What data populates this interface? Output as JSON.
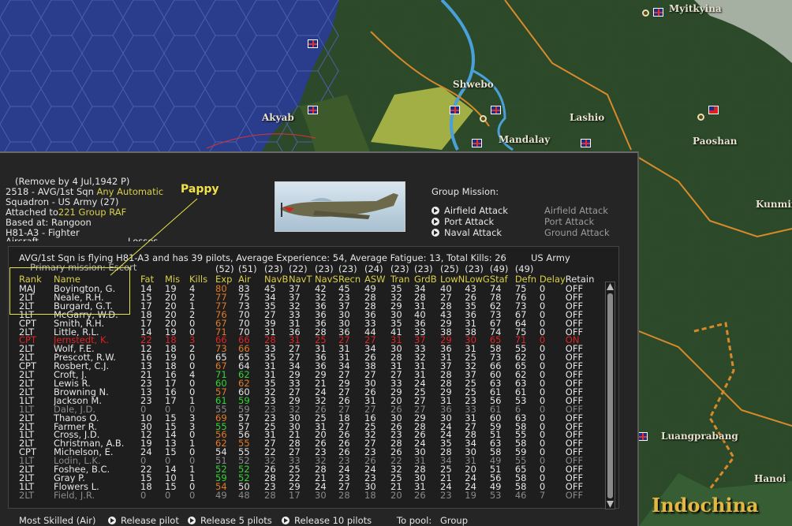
{
  "map": {
    "places": [
      "Myitkyina",
      "Akyab",
      "Shwebo",
      "Lashio",
      "Mandalay",
      "Paoshan",
      "Kunming",
      "Luangprabang",
      "Hanoi"
    ],
    "region": "Indochina",
    "flag_icon": "union-jack-flag-icon",
    "roc_flag_icon": "roc-flag-icon"
  },
  "unit": {
    "remove_line": "(Remove by  4 Jul,1942  P)",
    "id_line": "2518 - AVG/1st Sqn",
    "any": "Any",
    "automatic": "Automatic",
    "leader": "Pappy",
    "squadron_line": "Squadron - US Army (27)",
    "attached_label": "Attached to",
    "attached_value": "221 Group RAF",
    "based_line": "Based at:  Rangoon",
    "aircraft_line": "H81-A3 - Fighter",
    "aircraft_cut": "Aircraft",
    "losses_cut": "Losses"
  },
  "mission": {
    "title": "Group Mission:",
    "options": [
      "Airfield Attack",
      "Port Attack",
      "Naval Attack"
    ],
    "secondary": [
      "Airfield Attack",
      "Port Attack",
      "Ground Attack"
    ]
  },
  "summary": {
    "line": "AVG/1st Sqn is flying H81-A3 and has 39 pilots,  Average Experience: 54,  Average Fatigue: 13,  Total Kills: 26",
    "service": "US Army",
    "primary": "Primary mission: Escort"
  },
  "max_row": [
    "(52)",
    "(51)",
    "(23)",
    "(22)",
    "(23)",
    "(23)",
    "(24)",
    "(23)",
    "(23)",
    "(25)",
    "(23)",
    "(49)",
    "(49)"
  ],
  "columns": [
    "Rank",
    "Name",
    "Fat",
    "Mis",
    "Kills",
    "Exp",
    "Air",
    "NavB",
    "NavT",
    "NavS",
    "Recn",
    "ASW",
    "Tran",
    "GrdB",
    "LowN",
    "LowG",
    "Staf",
    "Defn",
    "Delay",
    "Retain"
  ],
  "pilots": [
    {
      "rank": "MAJ",
      "name": "Boyington, G.",
      "vals": [
        "14",
        "19",
        "4",
        "80",
        "83",
        "45",
        "37",
        "42",
        "45",
        "49",
        "35",
        "34",
        "40",
        "43",
        "74",
        "75",
        "0",
        "OFF"
      ],
      "s": "n",
      "c": {
        "exp": "o"
      }
    },
    {
      "rank": "2LT",
      "name": "Neale, R.H.",
      "vals": [
        "15",
        "20",
        "2",
        "77",
        "75",
        "34",
        "37",
        "32",
        "23",
        "28",
        "32",
        "28",
        "27",
        "26",
        "78",
        "76",
        "0",
        "OFF"
      ],
      "s": "n",
      "c": {
        "exp": "o"
      }
    },
    {
      "rank": "2LT",
      "name": "Burgard, G.T.",
      "vals": [
        "17",
        "20",
        "1",
        "77",
        "73",
        "35",
        "32",
        "36",
        "37",
        "28",
        "29",
        "31",
        "28",
        "35",
        "62",
        "73",
        "0",
        "OFF"
      ],
      "s": "n",
      "c": {
        "exp": "o"
      }
    },
    {
      "rank": "1LT",
      "name": "McGarry, W.D.",
      "vals": [
        "18",
        "20",
        "2",
        "76",
        "70",
        "27",
        "33",
        "36",
        "30",
        "36",
        "30",
        "40",
        "43",
        "36",
        "73",
        "67",
        "0",
        "OFF"
      ],
      "s": "n",
      "c": {
        "exp": "o"
      }
    },
    {
      "rank": "CPT",
      "name": "Smith, R.H.",
      "vals": [
        "17",
        "20",
        "0",
        "67",
        "70",
        "39",
        "31",
        "36",
        "30",
        "33",
        "35",
        "36",
        "29",
        "31",
        "67",
        "64",
        "0",
        "OFF"
      ],
      "s": "n",
      "c": {
        "exp": "o"
      }
    },
    {
      "rank": "2LT",
      "name": "Little, R.L.",
      "vals": [
        "14",
        "19",
        "0",
        "71",
        "70",
        "31",
        "36",
        "28",
        "36",
        "44",
        "41",
        "33",
        "38",
        "38",
        "74",
        "75",
        "0",
        "OFF"
      ],
      "s": "n",
      "c": {
        "exp": "o"
      }
    },
    {
      "rank": "CPT",
      "name": "Jernstedt, K.",
      "vals": [
        "22",
        "18",
        "3",
        "66",
        "66",
        "28",
        "31",
        "25",
        "27",
        "27",
        "31",
        "37",
        "29",
        "30",
        "65",
        "71",
        "0",
        "ON"
      ],
      "s": "a",
      "c": {}
    },
    {
      "rank": "2LT",
      "name": "Wolf, F.E.",
      "vals": [
        "12",
        "18",
        "2",
        "73",
        "66",
        "33",
        "27",
        "31",
        "31",
        "34",
        "30",
        "33",
        "36",
        "31",
        "58",
        "55",
        "0",
        "OFF"
      ],
      "s": "n",
      "c": {
        "exp": "o",
        "air": "o"
      }
    },
    {
      "rank": "2LT",
      "name": "Prescott, R.W.",
      "vals": [
        "16",
        "19",
        "0",
        "65",
        "65",
        "35",
        "27",
        "36",
        "31",
        "26",
        "28",
        "32",
        "31",
        "25",
        "73",
        "62",
        "0",
        "OFF"
      ],
      "s": "n",
      "c": {}
    },
    {
      "rank": "CPT",
      "name": "Rosbert, C.J.",
      "vals": [
        "13",
        "18",
        "0",
        "67",
        "64",
        "31",
        "34",
        "36",
        "34",
        "38",
        "31",
        "31",
        "37",
        "32",
        "66",
        "65",
        "0",
        "OFF"
      ],
      "s": "n",
      "c": {
        "exp": "o"
      }
    },
    {
      "rank": "2LT",
      "name": "Croft, J.",
      "vals": [
        "21",
        "16",
        "4",
        "71",
        "62",
        "31",
        "29",
        "29",
        "27",
        "27",
        "27",
        "31",
        "28",
        "37",
        "60",
        "62",
        "0",
        "OFF"
      ],
      "s": "n",
      "c": {
        "exp": "g",
        "air": "g"
      }
    },
    {
      "rank": "2LT",
      "name": "Lewis R.",
      "vals": [
        "23",
        "17",
        "0",
        "60",
        "62",
        "35",
        "33",
        "21",
        "29",
        "30",
        "33",
        "24",
        "28",
        "25",
        "63",
        "63",
        "0",
        "OFF"
      ],
      "s": "n",
      "c": {
        "exp": "g",
        "air": "o"
      }
    },
    {
      "rank": "2LT",
      "name": "Browning N.",
      "vals": [
        "13",
        "16",
        "0",
        "57",
        "60",
        "32",
        "27",
        "24",
        "27",
        "26",
        "29",
        "25",
        "29",
        "25",
        "61",
        "61",
        "0",
        "OFF"
      ],
      "s": "n",
      "c": {
        "exp": "o"
      }
    },
    {
      "rank": "1LT",
      "name": "Jackson M.",
      "vals": [
        "23",
        "17",
        "1",
        "61",
        "59",
        "23",
        "29",
        "32",
        "26",
        "31",
        "20",
        "27",
        "31",
        "23",
        "56",
        "53",
        "0",
        "OFF"
      ],
      "s": "n",
      "c": {
        "exp": "g",
        "air": "g"
      }
    },
    {
      "rank": "1LT",
      "name": "Dale, J.D.",
      "vals": [
        "0",
        "0",
        "0",
        "55",
        "59",
        "23",
        "32",
        "26",
        "27",
        "27",
        "26",
        "27",
        "36",
        "33",
        "61",
        "6",
        "0",
        "OFF"
      ],
      "s": "d",
      "c": {}
    },
    {
      "rank": "2LT",
      "name": "Thanos O.",
      "vals": [
        "10",
        "15",
        "3",
        "69",
        "57",
        "23",
        "30",
        "25",
        "18",
        "16",
        "30",
        "29",
        "30",
        "31",
        "60",
        "63",
        "0",
        "OFF"
      ],
      "s": "n",
      "c": {
        "exp": "o"
      }
    },
    {
      "rank": "2LT",
      "name": "Farmer R.",
      "vals": [
        "30",
        "15",
        "3",
        "55",
        "57",
        "25",
        "30",
        "31",
        "27",
        "25",
        "26",
        "28",
        "24",
        "27",
        "59",
        "58",
        "0",
        "OFF"
      ],
      "s": "n",
      "c": {
        "exp": "g"
      }
    },
    {
      "rank": "1LT",
      "name": "Cross, J.D.",
      "vals": [
        "12",
        "14",
        "0",
        "56",
        "56",
        "31",
        "21",
        "20",
        "26",
        "32",
        "23",
        "26",
        "24",
        "28",
        "51",
        "55",
        "0",
        "OFF"
      ],
      "s": "n",
      "c": {
        "exp": "o"
      }
    },
    {
      "rank": "2LT",
      "name": "Christman, A.B.",
      "vals": [
        "19",
        "13",
        "1",
        "62",
        "55",
        "27",
        "28",
        "26",
        "26",
        "27",
        "28",
        "24",
        "35",
        "34",
        "63",
        "58",
        "0",
        "OFF"
      ],
      "s": "n",
      "c": {
        "exp": "o",
        "air": "o"
      }
    },
    {
      "rank": "CPT",
      "name": "Michelson, E.",
      "vals": [
        "24",
        "15",
        "0",
        "54",
        "55",
        "22",
        "27",
        "23",
        "26",
        "23",
        "26",
        "30",
        "28",
        "30",
        "58",
        "59",
        "0",
        "OFF"
      ],
      "s": "n",
      "c": {}
    },
    {
      "rank": "1LT",
      "name": "Lodin, L.K.",
      "vals": [
        "0",
        "0",
        "0",
        "51",
        "52",
        "32",
        "33",
        "32",
        "23",
        "26",
        "22",
        "31",
        "34",
        "31",
        "49",
        "55",
        "0",
        "OFF"
      ],
      "s": "d",
      "c": {}
    },
    {
      "rank": "2LT",
      "name": "Foshee, B.C.",
      "vals": [
        "22",
        "14",
        "1",
        "52",
        "52",
        "26",
        "25",
        "28",
        "24",
        "24",
        "32",
        "28",
        "25",
        "20",
        "51",
        "65",
        "0",
        "OFF"
      ],
      "s": "n",
      "c": {
        "exp": "g",
        "air": "g"
      }
    },
    {
      "rank": "2LT",
      "name": "Gray P.",
      "vals": [
        "15",
        "10",
        "1",
        "59",
        "52",
        "28",
        "22",
        "21",
        "23",
        "23",
        "25",
        "30",
        "21",
        "24",
        "56",
        "58",
        "0",
        "OFF"
      ],
      "s": "n",
      "c": {
        "exp": "g",
        "air": "g"
      }
    },
    {
      "rank": "1LT",
      "name": "Flowers L.",
      "vals": [
        "18",
        "15",
        "0",
        "54",
        "50",
        "23",
        "29",
        "24",
        "27",
        "30",
        "21",
        "31",
        "24",
        "24",
        "49",
        "58",
        "0",
        "OFF"
      ],
      "s": "n",
      "c": {
        "exp": "o"
      }
    },
    {
      "rank": "2LT",
      "name": "Field, J.R.",
      "vals": [
        "0",
        "0",
        "0",
        "49",
        "48",
        "28",
        "17",
        "30",
        "28",
        "18",
        "20",
        "26",
        "23",
        "19",
        "53",
        "46",
        "7",
        "OFF"
      ],
      "s": "d",
      "c": {}
    }
  ],
  "bottom": {
    "most_skilled": "Most Skilled (Air)",
    "release_pilot": "Release pilot",
    "release_5": "Release 5 pilots",
    "release_10": "Release 10 pilots",
    "to_pool": "To pool:",
    "pool_value": "Group"
  }
}
